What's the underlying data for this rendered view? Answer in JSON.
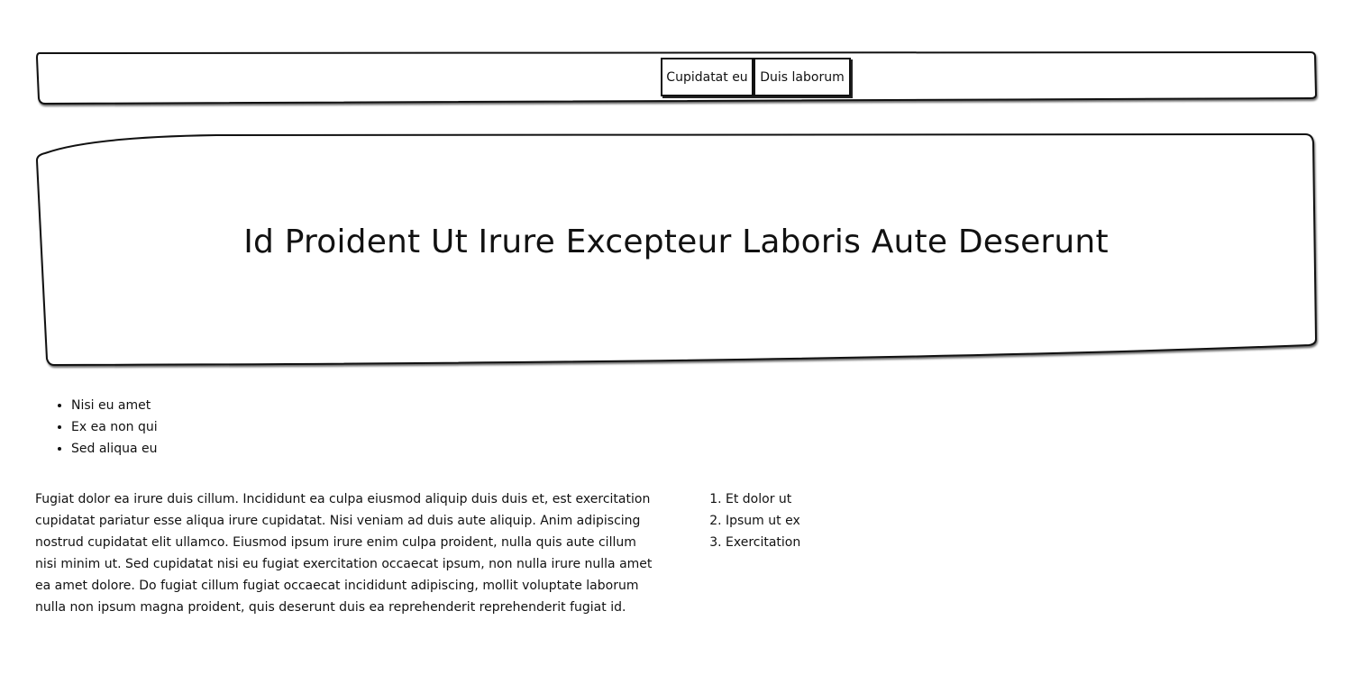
{
  "nav": {
    "buttons": [
      {
        "label": "Cupidatat eu"
      },
      {
        "label": "Duis laborum"
      }
    ]
  },
  "hero": {
    "title": "Id Proident Ut Irure Excepteur Laboris Aute Deserunt"
  },
  "bullets": [
    "Nisi eu amet",
    "Ex ea non qui",
    "Sed aliqua eu"
  ],
  "paragraph": "Fugiat dolor ea irure duis cillum. Incididunt ea culpa eiusmod aliquip duis duis et, est exercitation cupidatat pariatur esse aliqua irure cupidatat. Nisi veniam ad duis aute aliquip. Anim adipiscing nostrud cupidatat elit ullamco. Eiusmod ipsum irure enim culpa proident, nulla quis aute cillum nisi minim ut. Sed cupidatat nisi eu fugiat exercitation occaecat ipsum, non nulla irure nulla amet ea amet dolore. Do fugiat cillum fugiat occaecat incididunt adipiscing, mollit voluptate laborum nulla non ipsum magna proident, quis deserunt duis ea reprehenderit reprehenderit fugiat id.",
  "ordered": [
    "Et dolor ut",
    "Ipsum ut ex",
    "Exercitation"
  ]
}
